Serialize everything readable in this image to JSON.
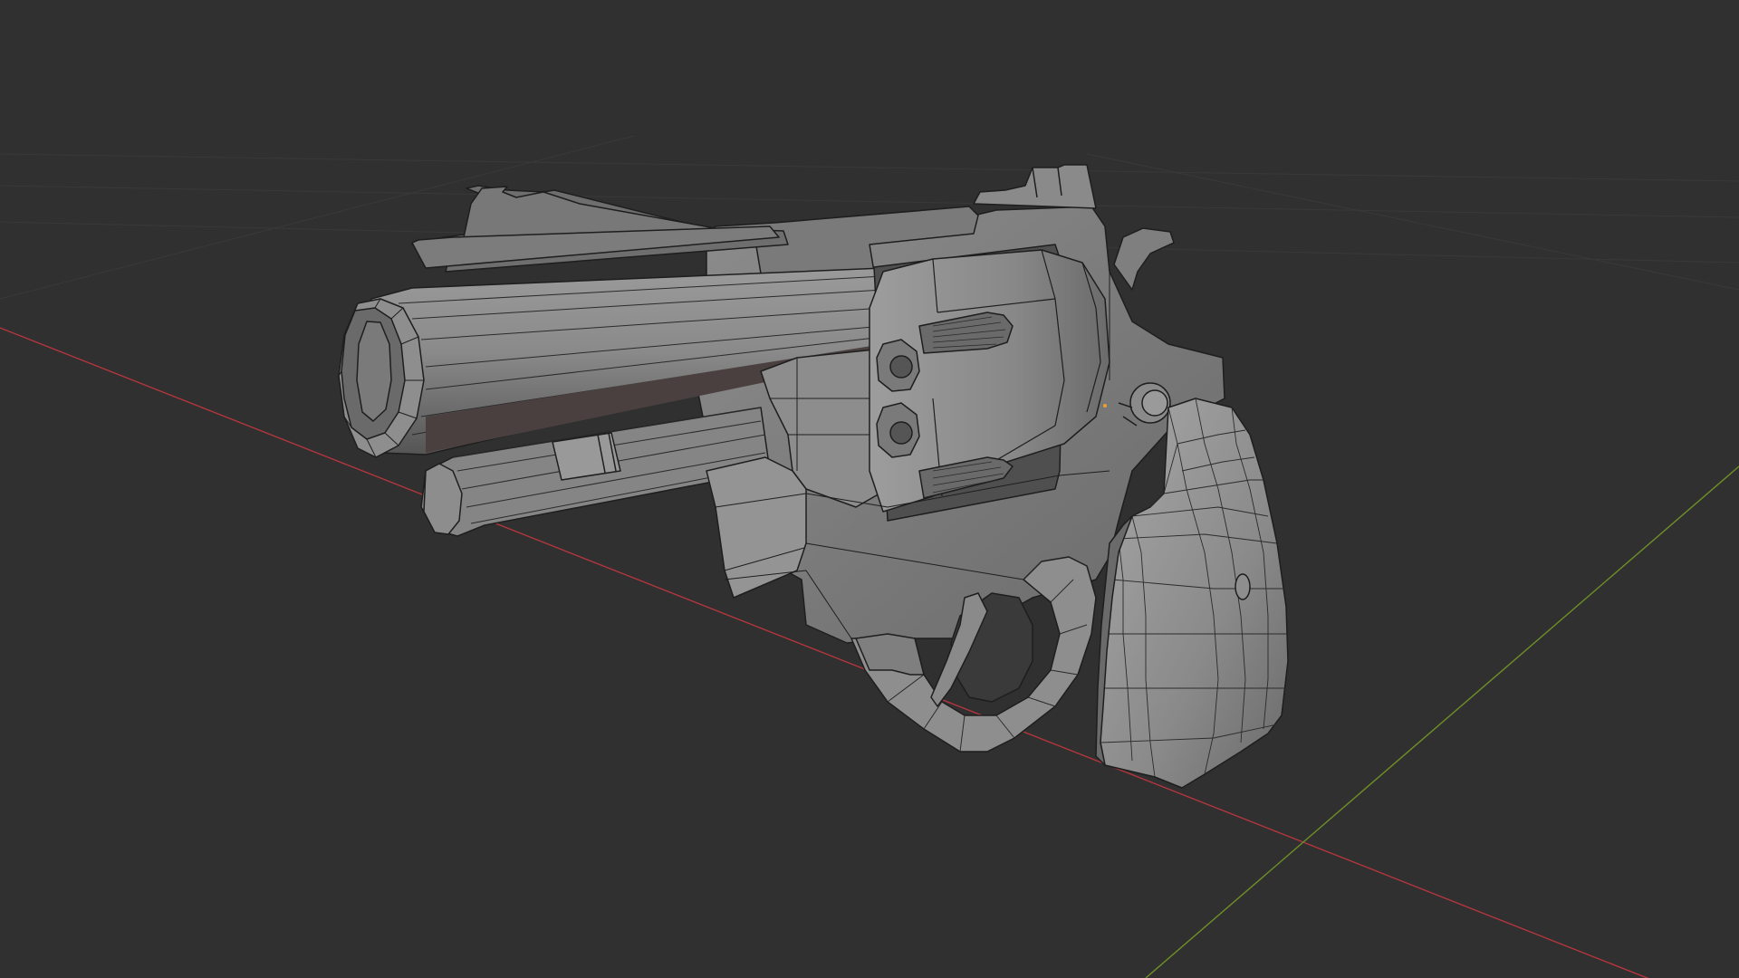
{
  "viewport": {
    "background": "#303030",
    "shading_mode": "solid",
    "overlay_wireframe": true,
    "grid": true,
    "axes": [
      {
        "name": "x-axis-line",
        "color": "#b1363d"
      },
      {
        "name": "y-axis-line",
        "color": "#6f8f26"
      }
    ]
  },
  "model": {
    "icon": "revolver-mesh",
    "base_color": "#858585",
    "light_color": "#a3a3a3",
    "dark_color": "#5e5e5e",
    "edge_color": "#1e1e1e",
    "selected_vertex_color": "#f0a030"
  }
}
